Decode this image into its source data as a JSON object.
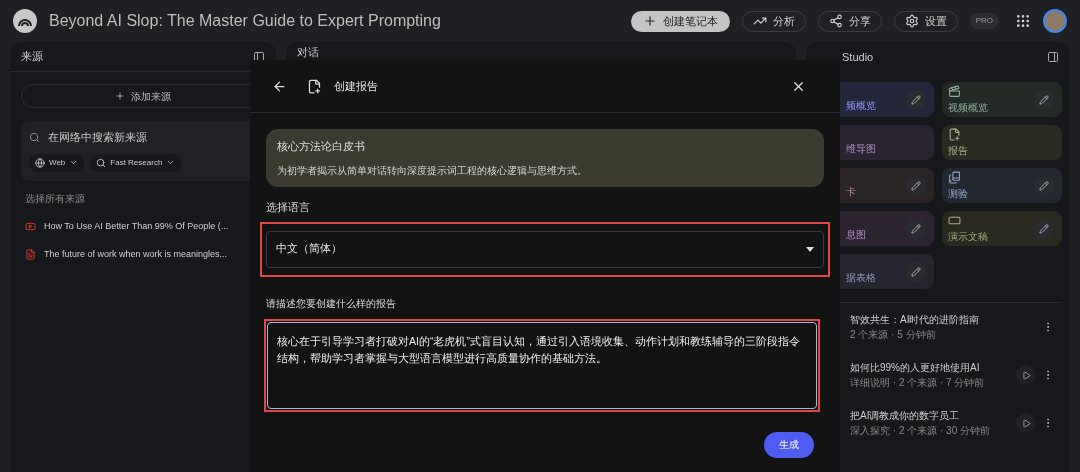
{
  "header": {
    "title": "Beyond AI Slop: The Master Guide to Expert Prompting",
    "buttons": [
      {
        "label": "创建笔记本",
        "kind": "primary"
      },
      {
        "label": "分析",
        "kind": "analytics"
      },
      {
        "label": "分享",
        "kind": "share"
      },
      {
        "label": "设置",
        "kind": "settings"
      }
    ],
    "badge": "PRO"
  },
  "sources": {
    "title": "来源",
    "add_button": "添加来源",
    "search": {
      "placeholder": "在网络中搜索新来源",
      "chips": [
        "Web",
        "Fast Research"
      ]
    },
    "select_all": "选择所有来源",
    "items": [
      {
        "kind": "video",
        "title": "How To Use AI Better Than 99% Of People (..."
      },
      {
        "kind": "doc",
        "title": "The future of work when work is meaningles..."
      }
    ]
  },
  "chat": {
    "title": "对话"
  },
  "studio": {
    "title": "Studio",
    "cards": [
      {
        "title": "频概览",
        "color": "#23253a",
        "kind": "hidden",
        "editable": true
      },
      {
        "title": "视频概览",
        "color": "#232a26",
        "kind": "video",
        "editable": true
      },
      {
        "title": "维导图",
        "color": "#2a2330",
        "kind": "hidden",
        "editable": false
      },
      {
        "title": "报告",
        "color": "#2a2a22",
        "kind": "report",
        "editable": false
      },
      {
        "title": "卡",
        "color": "#2b2424",
        "kind": "hidden",
        "editable": true
      },
      {
        "title": "测验",
        "color": "#232830",
        "kind": "quiz",
        "editable": true
      },
      {
        "title": "息图",
        "color": "#2b2330",
        "kind": "hidden",
        "editable": true
      },
      {
        "title": "演示文稿",
        "color": "#29291f",
        "kind": "slides",
        "editable": true
      },
      {
        "title": "据表格",
        "color": "#24252e",
        "kind": "hidden",
        "editable": true
      }
    ],
    "outputs": [
      {
        "title": "智效共生：AI时代的进阶指南",
        "meta": "2 个来源 · 5 分钟前",
        "play": false
      },
      {
        "title": "如何比99%的人更好地使用AI",
        "meta": "详细说明 · 2 个来源 · 7 分钟前",
        "play": true
      },
      {
        "title": "把AI调教成你的数字员工",
        "meta": "深入探究 · 2 个来源 · 30 分钟前",
        "play": true
      }
    ]
  },
  "dialog": {
    "title": "创建报告",
    "format": {
      "title": "核心方法论白皮书",
      "description": "为初学者揭示从简单对话转向深度提示词工程的核心逻辑与思维方式。"
    },
    "language_label": "选择语言",
    "language": "中文（简体）",
    "prompt_label": "请描述您要创建什么样的报告",
    "prompt": "核心在于引导学习者打破对AI的“老虎机”式盲目认知，通过引入语境收集、动作计划和教练辅导的三阶段指令结构，帮助学习者掌握与大型语言模型进行高质量协作的基础方法。",
    "submit": "生成"
  }
}
